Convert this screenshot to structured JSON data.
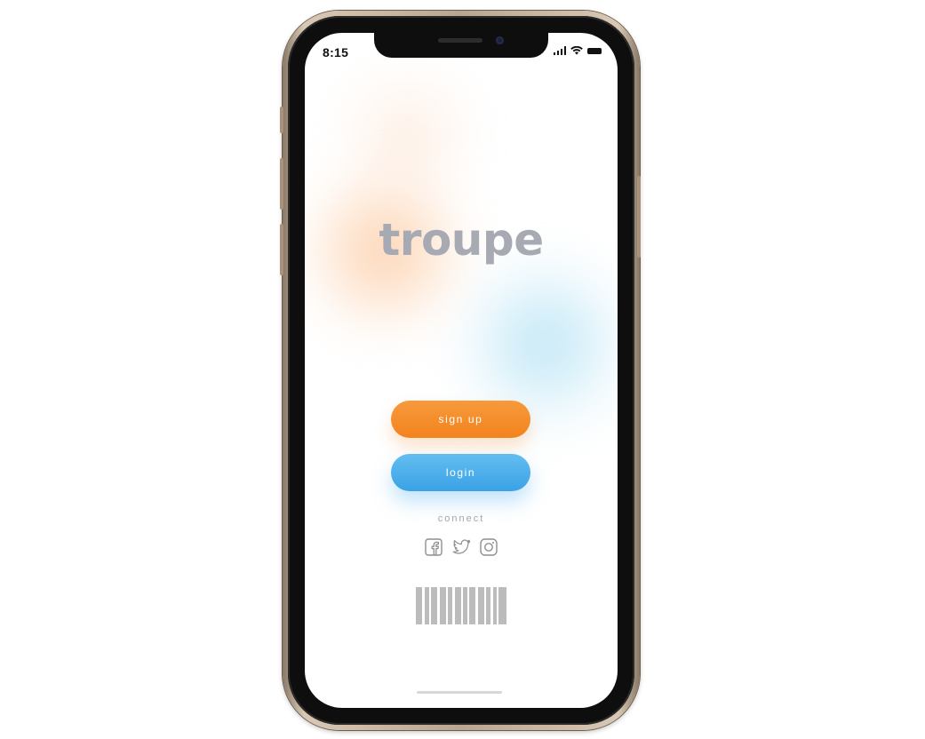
{
  "status_bar": {
    "time": "8:15",
    "icons": [
      "cellular-signal-icon",
      "wifi-icon",
      "battery-icon"
    ]
  },
  "app": {
    "title": "troupe",
    "signup_label": "sign up",
    "login_label": "login",
    "connect_label": "connect",
    "social_icons": [
      "facebook-icon",
      "twitter-icon",
      "instagram-icon"
    ],
    "footer_graphic": "barcode-icon"
  },
  "colors": {
    "title": "#a7aab3",
    "signup_button": "#f38a26",
    "login_button": "#48abea",
    "connect_text": "#a6a6a6",
    "social_icon": "#8e8e8e",
    "barcode": "#bcbcbc",
    "orange_glow": "#fcc496",
    "blue_glow": "#a0daf2"
  }
}
